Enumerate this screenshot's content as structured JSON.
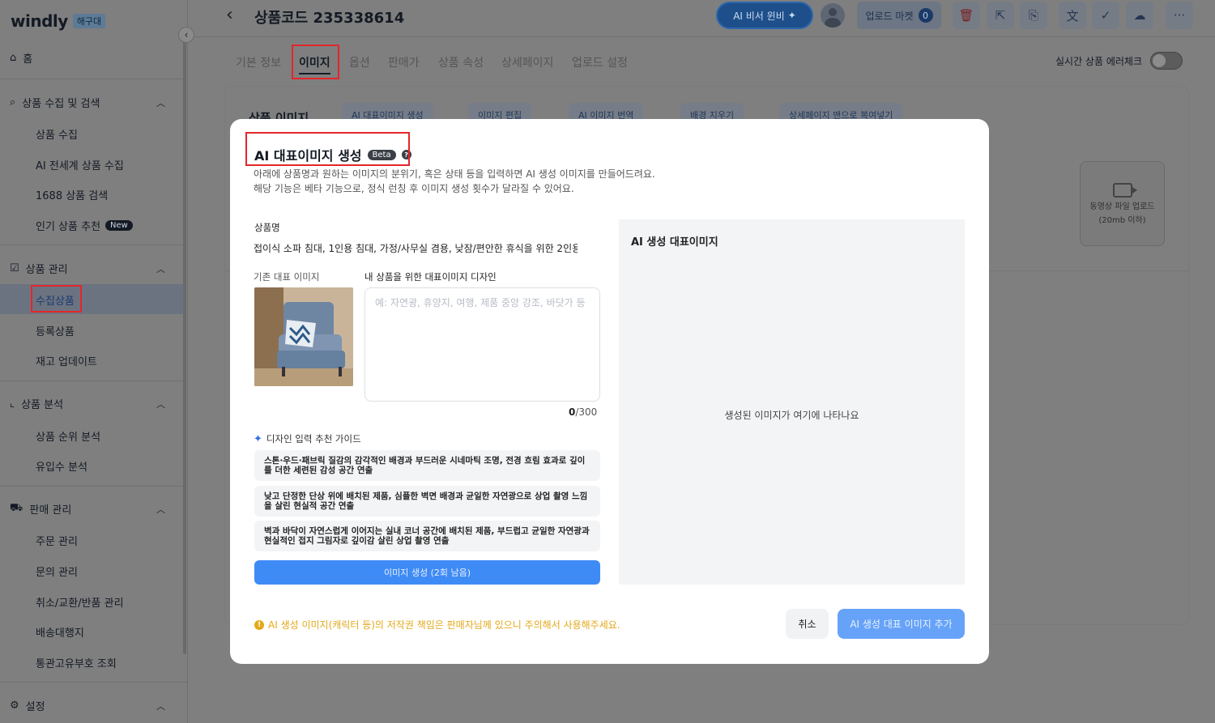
{
  "app": {
    "logo": "windly",
    "logo_badge": "해구대"
  },
  "sidebar": {
    "home": "홈",
    "sections": [
      {
        "title": "상품 수집 및 검색",
        "items": [
          "상품 수집",
          "AI 전세계 상품 수집",
          "1688 상품 검색",
          "인기 상품 추천"
        ]
      },
      {
        "title": "상품 관리",
        "items": [
          "수집상품",
          "등록상품",
          "재고 업데이트"
        ]
      },
      {
        "title": "상품 분석",
        "items": [
          "상품 순위 분석",
          "유입수 분석"
        ]
      },
      {
        "title": "판매 관리",
        "items": [
          "주문 관리",
          "문의 관리",
          "취소/교환/반품 관리",
          "배송대행지",
          "통관고유부호 조회"
        ]
      },
      {
        "title": "설정",
        "items": []
      }
    ],
    "new_badge": "New"
  },
  "header": {
    "title": "상품코드 235338614",
    "ai_assistant": "AI 비서 윈비",
    "upload_market": "업로드 마켓",
    "upload_count": "0"
  },
  "tabs": [
    "기본 정보",
    "이미지",
    "옵션",
    "판매가",
    "상품 속성",
    "상세페이지",
    "업로드 설정"
  ],
  "realtime_check": "실시간 상품 에러체크",
  "background": {
    "section_title": "상품 이미지",
    "pills": [
      "AI 대표이미지 생성",
      "이미지 편집",
      "AI 이미지 번역",
      "배경 지우기",
      "상세페이지 맨으로 복여넣기"
    ],
    "video_upload": "동영상 파일 업로드",
    "video_limit": "(20mb 이하)"
  },
  "modal": {
    "title": "AI 대표이미지 생성",
    "beta": "Beta",
    "desc1": "아래에 상품명과 원하는 이미지의 분위기, 혹은 상태 등을 입력하면 AI 생성 이미지를 만들어드려요.",
    "desc2": "해당 기능은 베타 기능으로, 정식 런칭 후 이미지 생성 횟수가 달라질 수 있어요.",
    "product_label": "상품명",
    "product_name": "접이식 소파 침대, 1인용 침대, 가정/사무실 겸용, 낮잠/편안한 휴식을 위한 2인용 ...",
    "existing_label": "기존 대표 이미지",
    "design_label": "내 상품을 위한 대표이미지 디자인",
    "design_placeholder": "예: 자연광, 휴양지, 여행, 제품 중앙 강조, 바닷가 등",
    "counter_current": "0",
    "counter_max": "/300",
    "guide_title": "디자인 입력 추천 가이드",
    "guides": [
      "스톤·우드·패브릭 질감의 감각적인 배경과 부드러운 시네마틱 조명, 전경 흐림 효과로 깊이를 더한 세련된 감성 공간 연출",
      "낮고 단정한 단상 위에 배치된 제품, 심플한 벽면 배경과 균일한 자연광으로 상업 촬영 느낌을 살린 현실적 공간 연출",
      "벽과 바닥이 자연스럽게 이어지는 실내 코너 공간에 배치된 제품, 부드럽고 균일한 자연광과 현실적인 접지 그림자로 깊이감 살린 상업 촬영 연출"
    ],
    "generate_button": "이미지 생성 (2회 남음)",
    "right_title": "AI 생성 대표이미지",
    "right_empty": "생성된 이미지가 여기에 나타나요",
    "warning": "AI 생성 이미지(캐릭터 등)의 저작권 책임은 판매자님께 있으니 주의해서 사용해주세요.",
    "cancel": "취소",
    "add": "AI 생성 대표 이미지 추가"
  }
}
